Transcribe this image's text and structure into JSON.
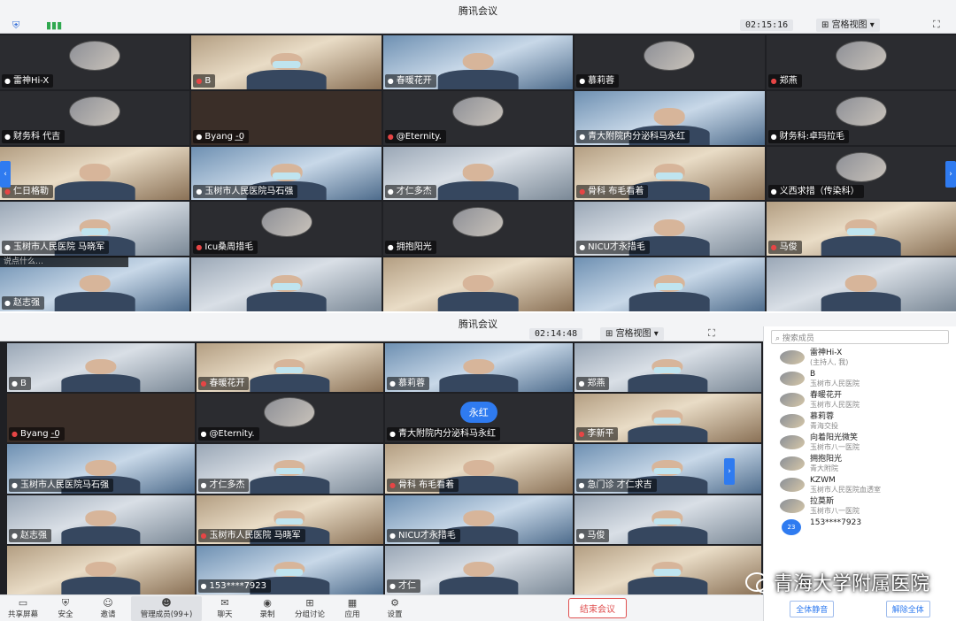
{
  "top": {
    "title": "腾讯会议",
    "timer": "02:15:16",
    "view_mode": "宫格视图",
    "input_hint": "说点什么…",
    "tiles": [
      {
        "name": "雷神Hi-X",
        "kind": "avatar"
      },
      {
        "name": "B",
        "kind": "video"
      },
      {
        "name": "春暖花开",
        "kind": "video"
      },
      {
        "name": "慕莉蓉",
        "kind": "avatar"
      },
      {
        "name": "郑燕",
        "kind": "avatar"
      },
      {
        "name": "财务科 代吉",
        "kind": "avatar"
      },
      {
        "name": "Byang -͟0",
        "kind": "dark"
      },
      {
        "name": "@Eternity.",
        "kind": "avatar"
      },
      {
        "name": "青大附院内分泌科马永红",
        "kind": "video"
      },
      {
        "name": "财务科:卓玛拉毛",
        "kind": "avatar"
      },
      {
        "name": "仁日格勒",
        "kind": "video"
      },
      {
        "name": "玉树市人民医院马石强",
        "kind": "video"
      },
      {
        "name": "才仁多杰",
        "kind": "video"
      },
      {
        "name": "骨科 布毛看着",
        "kind": "video"
      },
      {
        "name": "义西求措（传染科）",
        "kind": "avatar"
      },
      {
        "name": "玉树市人民医院 马晓军",
        "kind": "video"
      },
      {
        "name": "Icu桑周措毛",
        "kind": "avatar"
      },
      {
        "name": "拥抱阳光",
        "kind": "avatar"
      },
      {
        "name": "NICU才永措毛",
        "kind": "video"
      },
      {
        "name": "马俊",
        "kind": "video"
      },
      {
        "name": "赵志强",
        "kind": "video"
      },
      {
        "name": "",
        "kind": "video"
      },
      {
        "name": "",
        "kind": "video"
      },
      {
        "name": "",
        "kind": "video"
      },
      {
        "name": "",
        "kind": "video"
      }
    ]
  },
  "bottom": {
    "title": "腾讯会议",
    "timer": "02:14:48",
    "view_mode": "宫格视图",
    "chat_label": "聊天",
    "search_placeholder": "搜索成员",
    "tiles": [
      {
        "name": "B",
        "kind": "video"
      },
      {
        "name": "春暖花开",
        "kind": "video"
      },
      {
        "name": "慕莉蓉",
        "kind": "video"
      },
      {
        "name": "郑燕",
        "kind": "video"
      },
      {
        "name": "Byang -͟0",
        "kind": "dark"
      },
      {
        "name": "@Eternity.",
        "kind": "avatar"
      },
      {
        "name": "青大附院内分泌科马永红",
        "kind": "badge",
        "badge": "永红"
      },
      {
        "name": "李新平",
        "kind": "video"
      },
      {
        "name": "玉树市人民医院马石强",
        "kind": "video"
      },
      {
        "name": "才仁多杰",
        "kind": "video"
      },
      {
        "name": "骨科 布毛看着",
        "kind": "video"
      },
      {
        "name": "急门诊 才仁求吉",
        "kind": "video"
      },
      {
        "name": "赵志强",
        "kind": "video"
      },
      {
        "name": "玉树市人民医院 马晓军",
        "kind": "video"
      },
      {
        "name": "NICU才永措毛",
        "kind": "video"
      },
      {
        "name": "马俊",
        "kind": "video"
      },
      {
        "name": "",
        "kind": "video"
      },
      {
        "name": "153****7923",
        "kind": "video"
      },
      {
        "name": "才仁",
        "kind": "video"
      },
      {
        "name": "",
        "kind": "video"
      }
    ],
    "members": [
      {
        "name": "雷神Hi-X",
        "dept": "(主持人, 我)"
      },
      {
        "name": "B",
        "dept": "玉树市人民医院"
      },
      {
        "name": "春暖花开",
        "dept": "玉树市人民医院"
      },
      {
        "name": "慕莉蓉",
        "dept": "青海交投"
      },
      {
        "name": "向着阳光微笑",
        "dept": "玉树市八一医院"
      },
      {
        "name": "拥抱阳光",
        "dept": "青大附院"
      },
      {
        "name": "KZWM",
        "dept": "玉树市人民医院血透室"
      },
      {
        "name": "拉莫斯",
        "dept": "玉树市八一医院"
      },
      {
        "name": "153****7923",
        "dept": "",
        "num": "23"
      }
    ],
    "mute_all": "全体静音",
    "unmute_all": "解除全体",
    "toolbar": [
      {
        "label": "共享屏幕",
        "icon": "▭"
      },
      {
        "label": "安全",
        "icon": "⛨"
      },
      {
        "label": "邀请",
        "icon": "☺"
      },
      {
        "label": "管理成员(99+)",
        "icon": "☻"
      },
      {
        "label": "聊天",
        "icon": "✉"
      },
      {
        "label": "录制",
        "icon": "◉"
      },
      {
        "label": "分组讨论",
        "icon": "⊞"
      },
      {
        "label": "应用",
        "icon": "▦"
      },
      {
        "label": "设置",
        "icon": "⚙"
      }
    ],
    "end_meeting": "结束会议"
  },
  "watermark": "青海大学附属医院",
  "colors": {
    "accent": "#2f7bf0",
    "end": "#e05050",
    "grid_bg": "#1f2024"
  }
}
